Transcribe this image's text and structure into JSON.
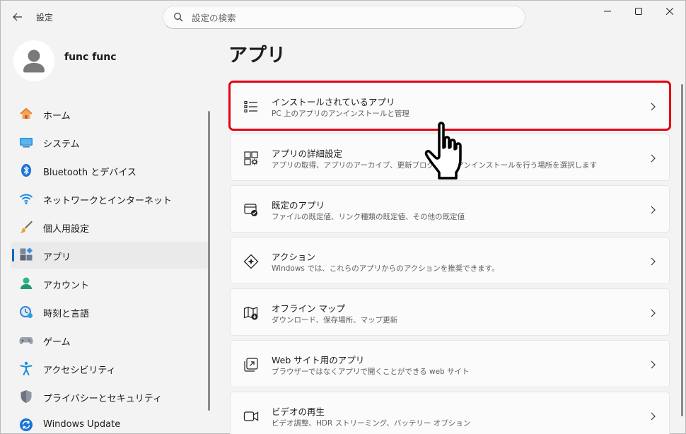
{
  "titlebar": {
    "app_title": "設定",
    "search_placeholder": "設定の検索"
  },
  "profile": {
    "name": "func func"
  },
  "sidebar": {
    "items": [
      {
        "label": "ホーム",
        "icon": "home-icon"
      },
      {
        "label": "システム",
        "icon": "system-icon"
      },
      {
        "label": "Bluetooth とデバイス",
        "icon": "bluetooth-icon"
      },
      {
        "label": "ネットワークとインターネット",
        "icon": "wifi-icon"
      },
      {
        "label": "個人用設定",
        "icon": "brush-icon"
      },
      {
        "label": "アプリ",
        "icon": "apps-icon",
        "active": true
      },
      {
        "label": "アカウント",
        "icon": "account-icon"
      },
      {
        "label": "時刻と言語",
        "icon": "clock-globe-icon"
      },
      {
        "label": "ゲーム",
        "icon": "gamepad-icon"
      },
      {
        "label": "アクセシビリティ",
        "icon": "accessibility-icon"
      },
      {
        "label": "プライバシーとセキュリティ",
        "icon": "shield-icon"
      },
      {
        "label": "Windows Update",
        "icon": "update-icon"
      }
    ]
  },
  "main": {
    "title": "アプリ",
    "cards": [
      {
        "title": "インストールされているアプリ",
        "subtitle": "PC 上のアプリのアンインストールと管理",
        "icon": "installed-apps-icon"
      },
      {
        "title": "アプリの詳細設定",
        "subtitle": "アプリの取得、アプリのアーカイブ、更新プログラムのアンインストールを行う場所を選択します",
        "icon": "advanced-settings-icon"
      },
      {
        "title": "既定のアプリ",
        "subtitle": "ファイルの既定値、リンク種類の既定値、その他の既定値",
        "icon": "default-apps-icon"
      },
      {
        "title": "アクション",
        "subtitle": "Windows では、これらのアプリからのアクションを推奨できます。",
        "icon": "actions-icon"
      },
      {
        "title": "オフライン マップ",
        "subtitle": "ダウンロード、保存場所、マップ更新",
        "icon": "offline-maps-icon"
      },
      {
        "title": "Web サイト用のアプリ",
        "subtitle": "ブラウザーではなくアプリで開くことができる web サイト",
        "icon": "web-apps-icon"
      },
      {
        "title": "ビデオの再生",
        "subtitle": "ビデオ調整、HDR ストリーミング、バッテリー オプション",
        "icon": "video-playback-icon"
      }
    ]
  },
  "colors": {
    "accent": "#0067c0",
    "highlight": "#e60012"
  }
}
